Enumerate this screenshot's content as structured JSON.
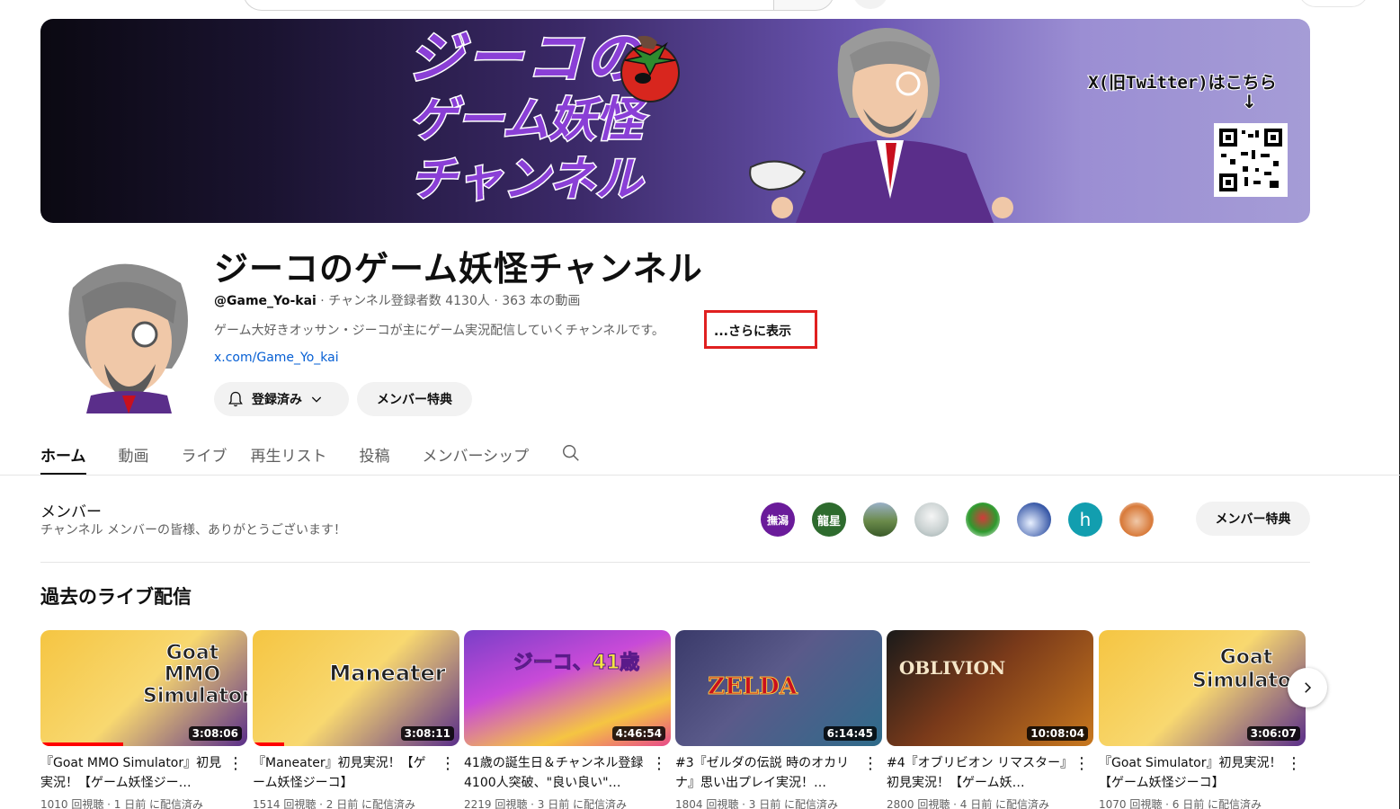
{
  "banner": {
    "title_line1": "ジーコの",
    "title_line2": "ゲーム妖怪",
    "title_line3": "チャンネル",
    "twitter_note": "X(旧Twitter)はこちら",
    "arrow": "↓"
  },
  "channel": {
    "name": "ジーコのゲーム妖怪チャンネル",
    "handle": "@Game_Yo-kai",
    "meta": " · チャンネル登録者数 4130人 · 363 本の動画",
    "description": "ゲーム大好きオッサン・ジーコが主にゲーム実況配信していくチャンネルです。",
    "more_label": "...さらに表示",
    "link": "x.com/Game_Yo_kai",
    "subscribed_label": "登録済み",
    "member_perks_label": "メンバー特典"
  },
  "tabs": [
    {
      "label": "ホーム"
    },
    {
      "label": "動画"
    },
    {
      "label": "ライブ"
    },
    {
      "label": "再生リスト"
    },
    {
      "label": "投稿"
    },
    {
      "label": "メンバーシップ"
    }
  ],
  "members": {
    "title": "メンバー",
    "subtitle": "チャンネル メンバーの皆様、ありがとうございます！",
    "avatars": [
      {
        "text": "撫潟",
        "color": "#6a1b9a"
      },
      {
        "text": "龍星",
        "color": "#2e6b2e"
      },
      {
        "text": "",
        "color": "#7a9a5a"
      },
      {
        "text": "",
        "color": "#c8d0d0"
      },
      {
        "text": "",
        "color": "#d33a3a"
      },
      {
        "text": "",
        "color": "#3a5aa8"
      },
      {
        "text": "h",
        "color": "#129eaf"
      },
      {
        "text": "",
        "color": "#d87a3a"
      }
    ],
    "perks_button": "メンバー特典"
  },
  "past_lives": {
    "title": "過去のライブ配信",
    "videos": [
      {
        "thumb_text": "Goat MMO Simulator",
        "duration": "3:08:06",
        "title": "『Goat MMO Simulator』初見実況！【ゲーム妖怪ジー…",
        "meta": "1010 回視聴 · 1 日前 に配信済み",
        "progress": 0.4,
        "bg": "#f5c542"
      },
      {
        "thumb_text": "Maneater",
        "duration": "3:08:11",
        "title": "『Maneater』初見実況！【ゲーム妖怪ジーコ】",
        "meta": "1514 回視聴 · 2 日前 に配信済み",
        "progress": 0.15,
        "bg": "#f5c542"
      },
      {
        "thumb_text": "ジーコ、41歳",
        "duration": "4:46:54",
        "title": "41歳の誕生日＆チャンネル登録4100人突破、\"良い良い\"…",
        "meta": "2219 回視聴 · 3 日前 に配信済み",
        "progress": 0,
        "bg": "#7a3fc8"
      },
      {
        "thumb_text": "ZELDA",
        "duration": "6:14:45",
        "title": "#3『ゼルダの伝説 時のオカリナ』思い出プレイ実況！…",
        "meta": "1804 回視聴 · 3 日前 に配信済み",
        "progress": 0,
        "bg": "#4a4a6a"
      },
      {
        "thumb_text": "OBLIVION",
        "duration": "10:08:04",
        "title": "#4『オブリビオン リマスター』初見実況！【ゲーム妖…",
        "meta": "2800 回視聴 · 4 日前 に配信済み",
        "progress": 0,
        "bg": "#7a3a1a"
      },
      {
        "thumb_text": "Goat Simulator",
        "duration": "3:06:07",
        "title": "『Goat Simulator』初見実況！【ゲーム妖怪ジーコ】",
        "meta": "1070 回視聴 · 6 日前 に配信済み",
        "progress": 0,
        "bg": "#f5c542"
      }
    ]
  }
}
